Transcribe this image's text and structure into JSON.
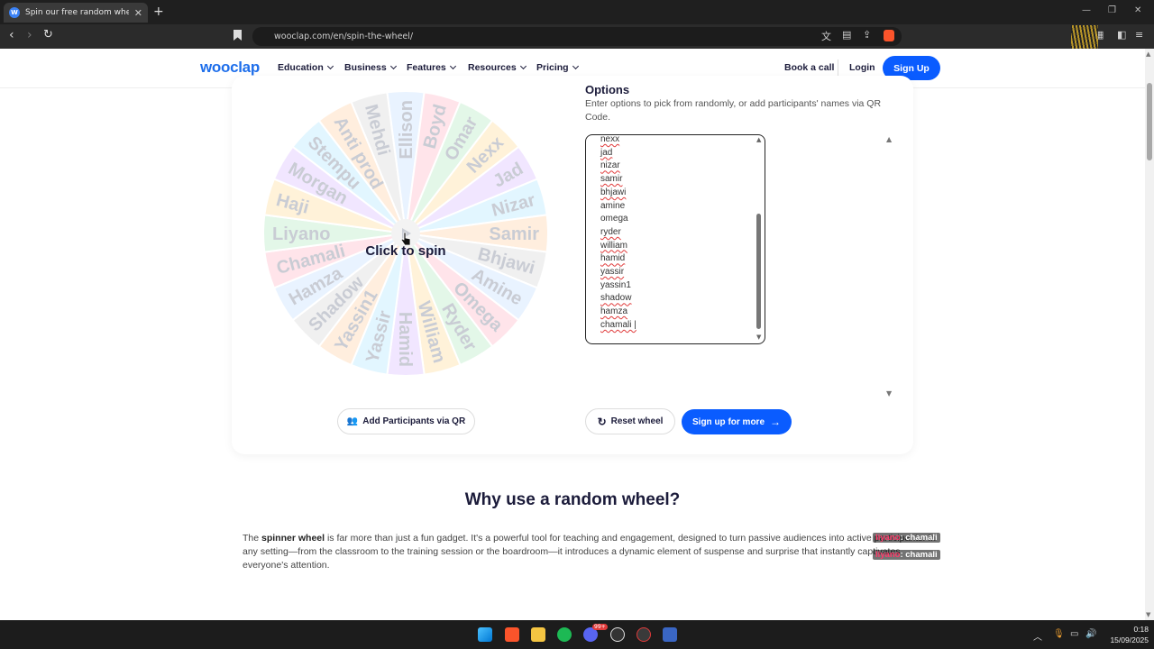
{
  "browser": {
    "tab_title": "Spin our free random wheel for a",
    "tab_icon": "W",
    "url": "wooclap.com/en/spin-the-wheel/"
  },
  "header": {
    "logo": "wooclap",
    "menu": [
      "Education",
      "Business",
      "Features",
      "Resources",
      "Pricing"
    ],
    "book_call": "Book a call",
    "login": "Login",
    "signup": "Sign Up"
  },
  "wheel": {
    "spin_label": "Click to spin",
    "names": [
      "Ellison",
      "Boyd",
      "Omar",
      "Nexx",
      "Jad",
      "Nizar",
      "Samir",
      "Bhjawi",
      "Amine",
      "Omega",
      "Ryder",
      "William",
      "Hamid",
      "Yassir",
      "Yassin1",
      "Shadow",
      "Hamza",
      "Chamali",
      "Liyano",
      "Haji",
      "Morgan",
      "Stempu",
      "Anti prod",
      "Mehdi"
    ],
    "colors": [
      "#e9f3ff",
      "#ffe4ea",
      "#e3f7e8",
      "#fff2d9",
      "#f1e6ff",
      "#e2f6ff",
      "#ffeede",
      "#f0f0f0"
    ]
  },
  "options": {
    "title": "Options",
    "description": "Enter options to pick from randomly, or add participants' names via QR Code.",
    "entries": [
      "nexx",
      "jad",
      "nizar",
      "samir",
      "bhjawi",
      "amine",
      "omega",
      "ryder",
      "william",
      "hamid",
      "yassir",
      "yassin1",
      "shadow",
      "hamza",
      "chamali"
    ]
  },
  "buttons": {
    "add_qr": "Add Participants via QR",
    "reset": "Reset wheel",
    "signup_more": "Sign up for more"
  },
  "why": {
    "title": "Why use a random wheel?",
    "p_pre": "The ",
    "p_bold": "spinner wheel",
    "p_post": " is far more than just a fun gadget. It's a powerful tool for teaching and engagement, designed to turn passive audiences into active participants. In any setting—from the classroom to the training session or the boardroom—it introduces a dynamic element of suspense and surprise that instantly captivates everyone's attention."
  },
  "overlay_chat": [
    {
      "name": "liyano",
      "text": ": chamali"
    },
    {
      "name": "liyano",
      "text": ": chamali"
    }
  ],
  "taskbar": {
    "time": "0:18",
    "date": "15/09/2025",
    "badge": "99+"
  }
}
